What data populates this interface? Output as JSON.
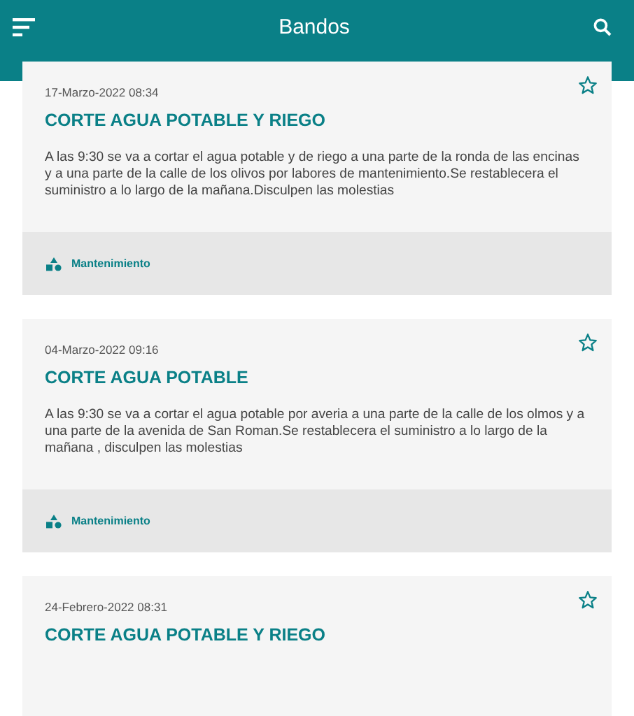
{
  "app_bar": {
    "title": "Bandos"
  },
  "notices": [
    {
      "date": "17-Marzo-2022 08:34",
      "title": "CORTE AGUA POTABLE Y RIEGO",
      "body": "A las 9:30 se va a cortar el agua potable  y de riego a una parte de la ronda de las encinas y a una parte de la calle de los olivos por labores de mantenimiento.Se restablecera el suministro a lo largo de la mañana.Disculpen las molestias",
      "category": "Mantenimiento",
      "favorite": false
    },
    {
      "date": "04-Marzo-2022 09:16",
      "title": "CORTE AGUA POTABLE",
      "body": "A las 9:30 se va a  cortar el agua potable por averia a una parte de la calle de los olmos y a una parte de la avenida de San Roman.Se restablecera el suministro a lo largo de la mañana , disculpen las molestias",
      "category": "Mantenimiento",
      "favorite": false
    },
    {
      "date": "24-Febrero-2022 08:31",
      "title": "CORTE AGUA POTABLE Y RIEGO",
      "favorite": false
    }
  ]
}
